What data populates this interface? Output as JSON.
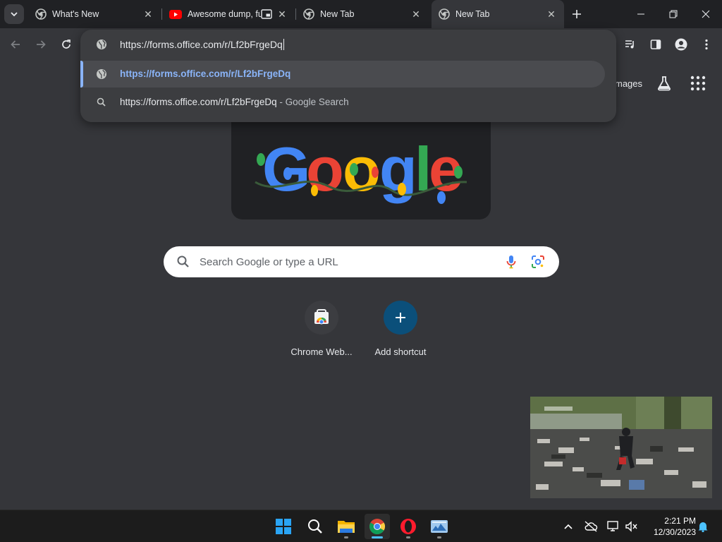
{
  "tabs": [
    {
      "title": "What's New",
      "icon": "chrome-icon"
    },
    {
      "title": "Awesome dump, fu",
      "icon": "youtube-icon"
    },
    {
      "title": "New Tab",
      "icon": "chrome-icon"
    },
    {
      "title": "New Tab",
      "icon": "chrome-icon"
    }
  ],
  "omnibox": {
    "text": "https://forms.office.com/r/Lf2bFrgeDq",
    "suggestions": [
      {
        "url": "https://forms.office.com/r/Lf2bFrgeDq",
        "suffix": ""
      },
      {
        "url": "https://forms.office.com/r/Lf2bFrgeDq",
        "suffix": " - Google Search"
      }
    ]
  },
  "ntp": {
    "images_label": "mages",
    "search_placeholder": "Search Google or type a URL",
    "shortcuts": [
      {
        "label": "Chrome Web..."
      },
      {
        "label": "Add shortcut"
      }
    ]
  },
  "taskbar": {
    "time": "2:21 PM",
    "date": "12/30/2023"
  },
  "colors": {
    "accent": "#8ab4f8",
    "background": "#35363a",
    "shortcut_add": "#0b4f7a"
  }
}
